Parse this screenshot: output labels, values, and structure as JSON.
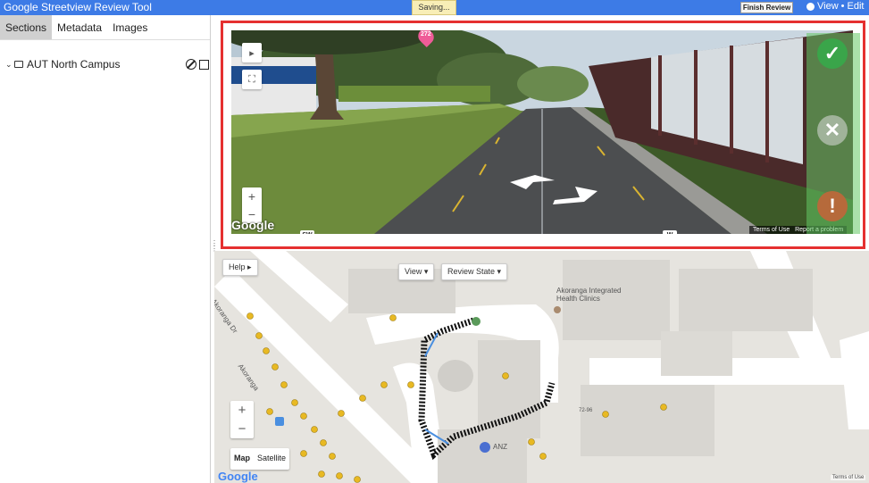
{
  "app": {
    "title": "Google Streetview Review Tool",
    "saving_text": "Saving...",
    "finish_label": "Finish Review",
    "mode_view": "View",
    "mode_sep": "•",
    "mode_edit": "Edit"
  },
  "sidebar": {
    "tabs": [
      {
        "label": "Sections",
        "active": true
      },
      {
        "label": "Metadata",
        "active": false
      },
      {
        "label": "Images",
        "active": false
      }
    ],
    "tree": [
      {
        "label": "AUT North Campus",
        "expanded": true
      }
    ]
  },
  "streetview": {
    "google_text": "Google",
    "terms": "Terms of Use",
    "report": "Report a problem",
    "compass_sw": "SW",
    "compass_w": "W",
    "pin_label": "272",
    "zoom_in": "+",
    "zoom_out": "−",
    "play_icon": "▸",
    "fullscreen_icon": "⛶"
  },
  "review": {
    "approve_icon": "check-icon",
    "reject_icon": "x-icon",
    "flag_icon": "exclamation-icon",
    "approve_glyph": "✓",
    "reject_glyph": "✕",
    "flag_glyph": "!"
  },
  "map": {
    "help_label": "Help ▸",
    "view_label": "View",
    "review_state_label": "Review State",
    "poi_label": "Akoranga Integrated\nHealth Clinics",
    "street1": "Akoranga Dr",
    "street2": "Akoranga",
    "bank": "ANZ",
    "map_type_map": "Map",
    "map_type_satellite": "Satellite",
    "zoom_in": "+",
    "zoom_out": "−",
    "google_text": "Google",
    "terms": "Terms of Use",
    "building_code": "72-96"
  },
  "colors": {
    "topbar": "#3d7be6",
    "highlight_border": "#e53030",
    "approve": "#3aa54a",
    "flag": "#b66a3b",
    "route": "#4a8fe0"
  }
}
